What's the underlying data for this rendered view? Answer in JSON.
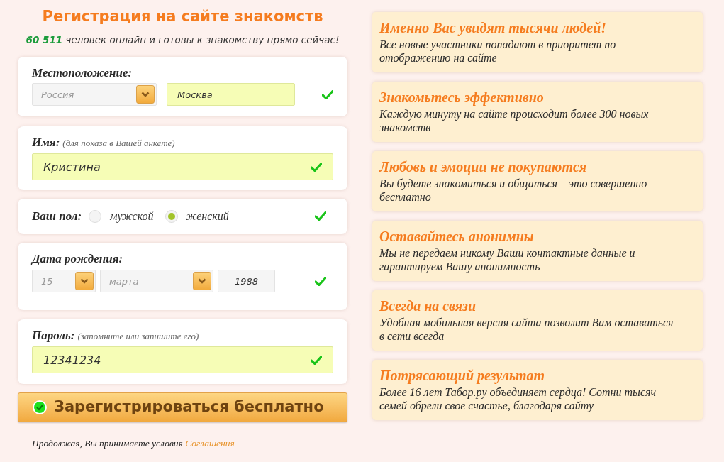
{
  "title": "Регистрация на сайте знакомств",
  "online": {
    "count": "60 511",
    "text": "человек онлайн и готовы к знакомству прямо сейчас!"
  },
  "location": {
    "label": "Местоположение:",
    "country": "Россия",
    "city": "Москва",
    "valid": true
  },
  "name": {
    "label": "Имя:",
    "hint": "(для показа в Вашей анкете)",
    "value": "Кристина",
    "valid": true
  },
  "gender": {
    "label": "Ваш пол:",
    "valid": true,
    "options": [
      {
        "label": "мужской",
        "selected": false
      },
      {
        "label": "женский",
        "selected": true
      }
    ]
  },
  "birth": {
    "label": "Дата рождения:",
    "day": "15",
    "month": "марта",
    "year": "1988",
    "valid": true
  },
  "password": {
    "label": "Пароль:",
    "hint": "(запомните или запишите его)",
    "value": "12341234",
    "valid": true
  },
  "submit": "Зарегистрироваться бесплатно",
  "terms": {
    "text": "Продолжая, Вы принимаете условия",
    "link": "Соглашения"
  },
  "features": [
    {
      "title": "Именно Вас увидят тысячи людей!",
      "text": "Все новые участники попадают в приоритет по отображению на сайте"
    },
    {
      "title": "Знакомьтесь эффективно",
      "text": "Каждую минуту на сайте происходит более 300 новых знакомств"
    },
    {
      "title": "Любовь и эмоции не покупаются",
      "text": "Вы будете знакомиться и общаться – это совершенно бесплатно"
    },
    {
      "title": "Оставайтесь анонимны",
      "text": "Мы не передаем никому Ваши контактные данные и гарантируем Вашу анонимность"
    },
    {
      "title": "Всегда на связи",
      "text": "Удобная мобильная версия сайта позволит Вам оставаться в сети всегда"
    },
    {
      "title": "Потрясающий результат",
      "text": "Более 16 лет Табор.ру объединяет сердца! Сотни тысяч семей обрели свое счастье, благодаря сайту"
    }
  ]
}
